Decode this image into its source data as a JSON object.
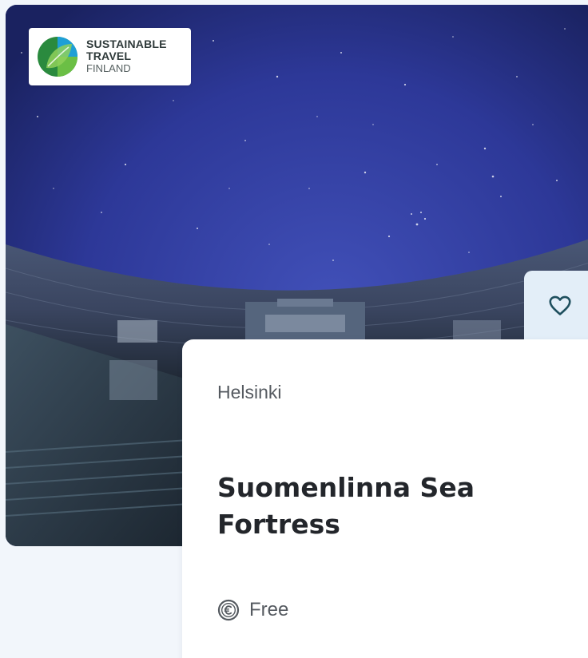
{
  "badge": {
    "line1": "SUSTAINABLE",
    "line2": "TRAVEL",
    "line3": "FINLAND",
    "logo_icon": "leaf-globe-icon",
    "logo_colors": [
      "#2d8f3a",
      "#6cc04a",
      "#1a9bd7"
    ]
  },
  "favorite": {
    "icon": "heart-icon"
  },
  "card": {
    "location": "Helsinki",
    "title": "Suomenlinna Sea Fortress",
    "price_icon": "euro-coin-icon",
    "price": "Free"
  },
  "colors": {
    "page_background": "#f2f6fb",
    "sky": "#2f3ba0",
    "favorite_background": "#e3eef8",
    "heart": "#1e4f5e",
    "text_primary": "#23262b",
    "text_secondary": "#555a60"
  }
}
